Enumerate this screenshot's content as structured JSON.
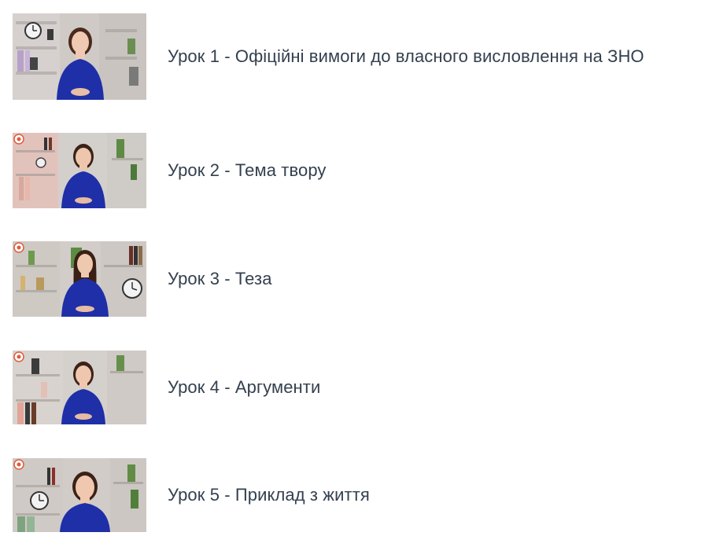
{
  "lessons": [
    {
      "title": "Урок 1 - Офіційні вимоги до власного висловлення на ЗНО",
      "thumbnail": "video-thumbnail",
      "badge": false
    },
    {
      "title": "Урок 2 - Тема твору",
      "thumbnail": "video-thumbnail",
      "badge": true
    },
    {
      "title": "Урок 3 - Теза",
      "thumbnail": "video-thumbnail",
      "badge": true
    },
    {
      "title": "Урок 4 - Аргументи",
      "thumbnail": "video-thumbnail",
      "badge": true
    },
    {
      "title": "Урок 5 - Приклад з життя",
      "thumbnail": "video-thumbnail",
      "badge": true
    }
  ],
  "colors": {
    "text": "#34404f",
    "dress": "#1f2fa8",
    "background": "#ffffff"
  }
}
